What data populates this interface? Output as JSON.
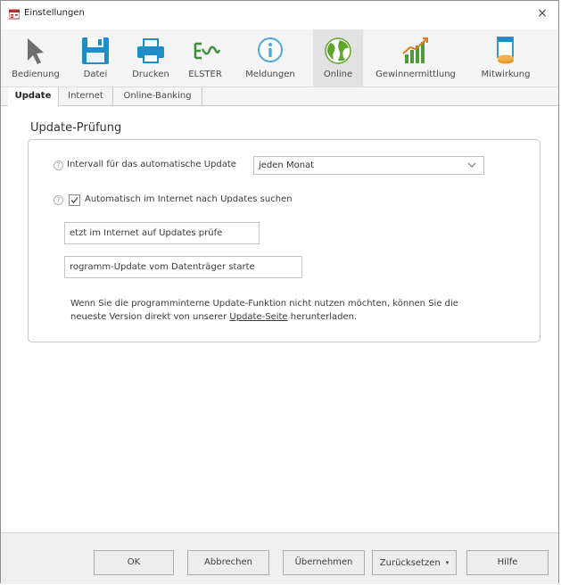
{
  "window": {
    "title": "Einstellungen",
    "close_glyph": "×"
  },
  "colors": {
    "ribbon_bg": "#f4f4f4",
    "active_tab_bg": "#e2e2e2",
    "arrow_gray": "#6e6e6e",
    "datei_blue": "#1e8ec6",
    "elster_green": "#3e8f3a",
    "info_blue": "#4aa8dc",
    "globe_green": "#5fa52a",
    "chart_green": "#4f9a3a",
    "chart_orange": "#e07b22"
  },
  "ribbon": {
    "items": [
      {
        "label": "Bedienung",
        "icon": "cursor-icon"
      },
      {
        "label": "Datei",
        "icon": "save-icon"
      },
      {
        "label": "Drucken",
        "icon": "printer-icon"
      },
      {
        "label": "ELSTER",
        "icon": "elster-icon"
      },
      {
        "label": "Meldungen",
        "icon": "info-icon"
      },
      {
        "label": "Online",
        "icon": "globe-icon",
        "active": true
      },
      {
        "label": "Gewinnermittlung",
        "icon": "bar-chart-icon"
      },
      {
        "label": "Mitwirkung",
        "icon": "document-coins-icon"
      }
    ]
  },
  "subtabs": [
    {
      "label": "Update",
      "active": true
    },
    {
      "label": "Internet"
    },
    {
      "label": "Online-Banking"
    }
  ],
  "update_section": {
    "title": "Update-Prüfung",
    "help_glyph": "?",
    "interval_label": "Intervall für das automatische Update",
    "interval_value": "jeden Monat",
    "auto_search_label": "Automatisch im Internet nach Updates suchen",
    "auto_search_checked": true,
    "check_now_button": "etzt im Internet auf Updates prüfe",
    "media_update_button": "rogramm-Update vom Datenträger starte",
    "info_text_before": "Wenn Sie die programminterne Update-Funktion nicht nutzen möchten, können Sie die neueste Version direkt von unserer ",
    "info_link": "Update-Seite",
    "info_text_after": " herunterladen."
  },
  "footer": {
    "ok": "OK",
    "cancel": "Abbrechen",
    "apply": "Übernehmen",
    "reset": "Zurücksetzen",
    "reset_caret": "▾",
    "help": "Hilfe"
  }
}
